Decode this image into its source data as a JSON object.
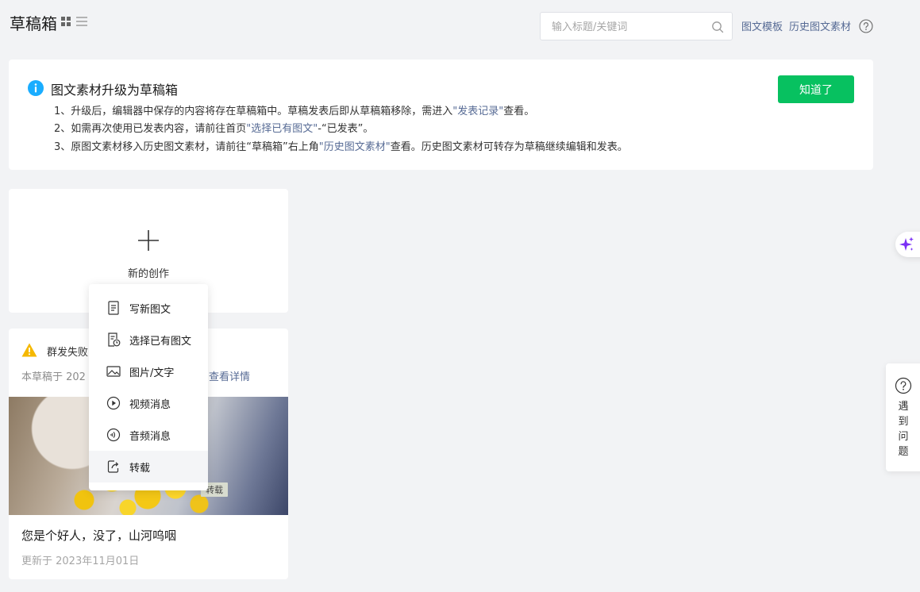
{
  "header": {
    "title": "草稿箱",
    "search_placeholder": "输入标题/关键词",
    "search_value": "",
    "link_template": "图文模板",
    "link_history": "历史图文素材"
  },
  "notice": {
    "title": "图文素材升级为草稿箱",
    "line1_pre": "1、升级后，编辑器中保存的内容将存在草稿箱中。草稿发表后即从草稿箱移除，需进入",
    "line1_link": "\"发表记录\"",
    "line1_post": "查看。",
    "line2_pre": "2、如需再次使用已发表内容，请前往首页",
    "line2_link": "\"选择已有图文\"",
    "line2_post": "-“已发表”。",
    "line3_pre": "3、原图文素材移入历史图文素材，请前往“草稿箱”右上角",
    "line3_link": "\"历史图文素材\"",
    "line3_post": "查看。历史图文素材可转存为草稿继续编辑和发表。",
    "ok_label": "知道了"
  },
  "new_card": {
    "label": "新的创作"
  },
  "draft": {
    "warning_text": "群发失败",
    "note": "本草稿于 202",
    "detail_link": "查看详情",
    "cover_tag": "转载",
    "title": "您是个好人，没了，山河呜咽",
    "updated": "更新于 2023年11月01日"
  },
  "menu": {
    "items": [
      {
        "label": "写新图文",
        "icon": "document-icon"
      },
      {
        "label": "选择已有图文",
        "icon": "document-clock-icon"
      },
      {
        "label": "图片/文字",
        "icon": "image-icon"
      },
      {
        "label": "视频消息",
        "icon": "play-icon"
      },
      {
        "label": "音频消息",
        "icon": "audio-icon"
      },
      {
        "label": "转载",
        "icon": "repost-icon"
      }
    ],
    "active_index": 5
  },
  "floaters": {
    "help_text": "遇到问题"
  },
  "colors": {
    "accent_green": "#07c160",
    "link_blue": "#576b95",
    "info_blue": "#1aadff",
    "warning_yellow": "#f5b800",
    "ai_purple": "#7a2ff5"
  }
}
